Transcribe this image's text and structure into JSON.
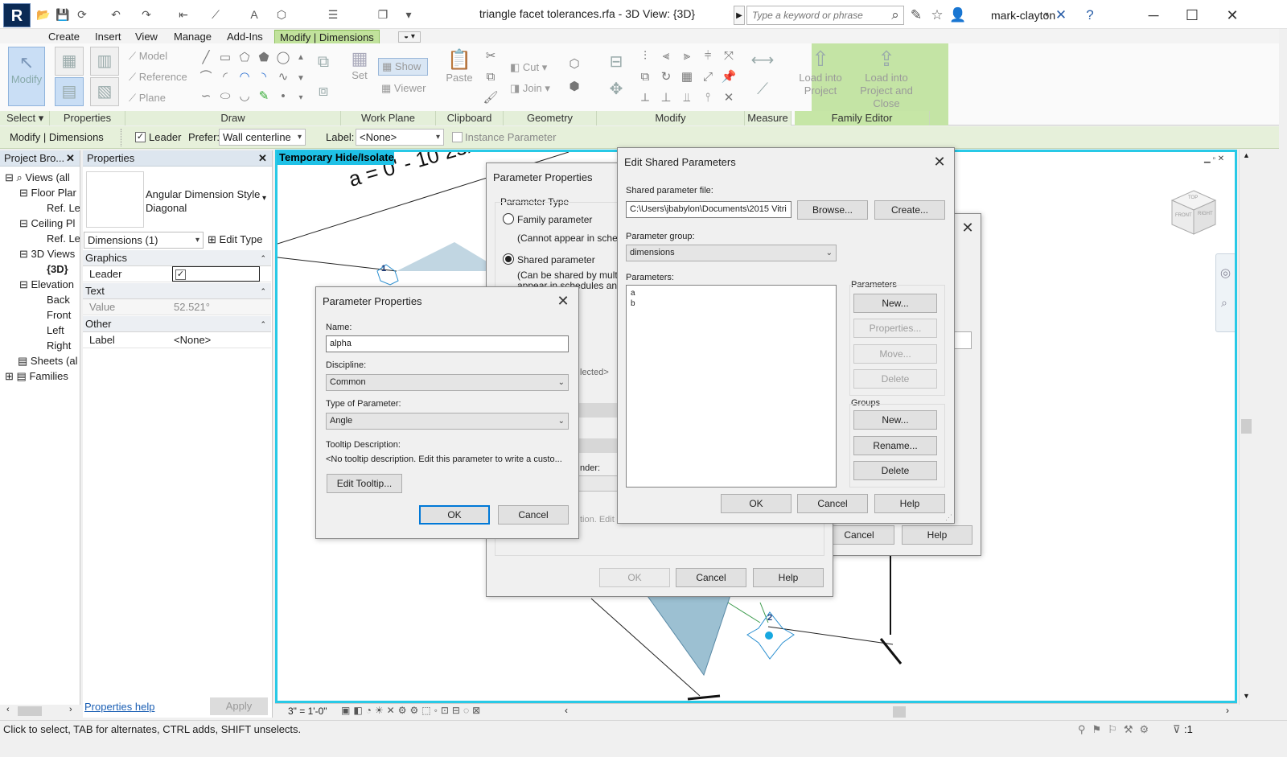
{
  "window": {
    "title": "triangle facet tolerances.rfa - 3D View: {3D}",
    "search_placeholder": "Type a keyword or phrase",
    "user": "mark-clayton"
  },
  "ribbon": {
    "tabs": [
      "Create",
      "Insert",
      "View",
      "Manage",
      "Add-Ins",
      "Modify | Dimensions"
    ],
    "active_tab": "Modify | Dimensions",
    "buttons": {
      "modify": "Modify",
      "model": "Model",
      "reference": "Reference",
      "plane": "Plane",
      "set": "Set",
      "show": "Show",
      "viewer": "Viewer",
      "paste": "Paste",
      "cut": "Cut",
      "join": "Join",
      "load_into_project_1": "Load into",
      "load_into_project_2": "Project",
      "load_close_1": "Load into",
      "load_close_2": "Project and Close"
    },
    "panels": [
      "Select",
      "Properties",
      "Draw",
      "Work Plane",
      "Clipboard",
      "Geometry",
      "Modify",
      "Measure",
      "Family Editor"
    ]
  },
  "options_bar": {
    "context": "Modify | Dimensions",
    "leader_label": "Leader",
    "leader_checked": true,
    "prefer_label": "Prefer:",
    "prefer_value": "Wall centerline",
    "label_label": "Label:",
    "label_value": "<None>",
    "instance_param_label": "Instance Parameter"
  },
  "project_browser": {
    "title": "Project Bro...",
    "items": [
      "Views (all",
      "Floor Plar",
      "Ref. Le",
      "Ceiling Pl",
      "Ref. Le",
      "3D Views",
      "{3D}",
      "Elevation",
      "Back",
      "Front",
      "Left",
      "Right",
      "Sheets (al",
      "Families"
    ]
  },
  "properties": {
    "title": "Properties",
    "type_name_1": "Angular Dimension Style",
    "type_name_2": "Diagonal",
    "selector": "Dimensions (1)",
    "edit_type": "Edit Type",
    "sections": {
      "graphics": "Graphics",
      "text": "Text",
      "other": "Other"
    },
    "rows": {
      "leader_label": "Leader",
      "value_label": "Value",
      "value": "52.521°",
      "label_label": "Label",
      "label_value": "<None>"
    },
    "help_link": "Properties help",
    "apply": "Apply"
  },
  "viewport": {
    "temp_label": "Temporary Hide/Isolate",
    "dimension_text": "a = 0' - 10 25/32\"",
    "marker_1": "1",
    "marker_2": "2",
    "viewcube_top": "TOP",
    "viewcube_front": "FRONT",
    "viewcube_right": "RIGHT",
    "scale": "3\" = 1'-0\""
  },
  "dialog_param_props_bg": {
    "title": "Parameter Properties",
    "param_type_label": "Parameter Type",
    "family_param": "Family parameter",
    "family_desc": "(Cannot appear in schedu",
    "shared_param": "Shared parameter",
    "shared_desc_1": "(Can be shared by multipl",
    "shared_desc_2": "appear in schedules and t",
    "frag_selected": "lected>",
    "frag_render": "nder:",
    "frag_edit": "tion. Edit th",
    "ok": "OK",
    "cancel": "Cancel",
    "help": "Help"
  },
  "dialog_param_props": {
    "title": "Parameter Properties",
    "name_label": "Name:",
    "name_value": "alpha",
    "discipline_label": "Discipline:",
    "discipline_value": "Common",
    "type_label": "Type of Parameter:",
    "type_value": "Angle",
    "tooltip_label": "Tooltip Description:",
    "tooltip_text": "<No tooltip description. Edit this parameter to write a custo...",
    "edit_tooltip": "Edit Tooltip...",
    "ok": "OK",
    "cancel": "Cancel"
  },
  "dialog_bg3": {
    "ok": "OK",
    "cancel": "Cancel",
    "help": "Help"
  },
  "dialog_shared": {
    "title": "Edit Shared Parameters",
    "file_label": "Shared parameter file:",
    "file_value": "C:\\Users\\jbabylon\\Documents\\2015 Vitri",
    "browse": "Browse...",
    "create": "Create...",
    "group_label": "Parameter group:",
    "group_value": "dimensions",
    "params_label": "Parameters:",
    "params": [
      "a",
      "b"
    ],
    "params_group_title": "Parameters",
    "p_new": "New...",
    "p_properties": "Properties...",
    "p_move": "Move...",
    "p_delete": "Delete",
    "groups_title": "Groups",
    "g_new": "New...",
    "g_rename": "Rename...",
    "g_delete": "Delete",
    "ok": "OK",
    "cancel": "Cancel",
    "help": "Help"
  },
  "status": {
    "text": "Click to select, TAB for alternates, CTRL adds, SHIFT unselects.",
    "filter_count": ":1"
  },
  "colors": {
    "accent": "#28c9e6",
    "context_tab": "#c1e29c",
    "options_bar": "#e6f0da",
    "focus": "#0078d7"
  }
}
